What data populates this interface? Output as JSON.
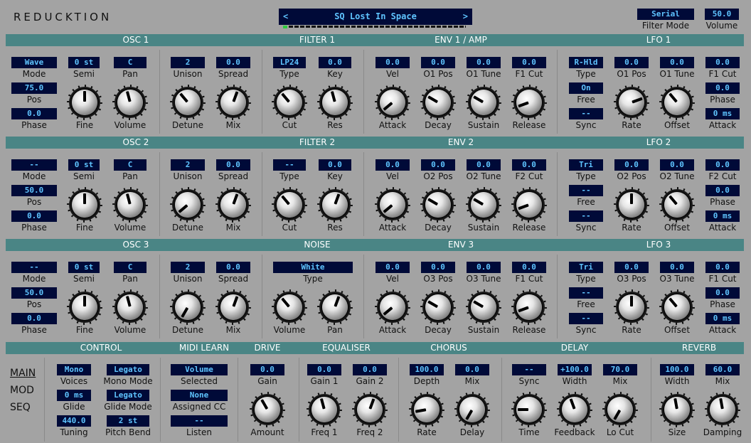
{
  "app_title": "REDUCKTION",
  "preset": {
    "prev": "<",
    "next": ">",
    "name": "SQ Lost In Space"
  },
  "header": {
    "filter_mode_value": "Serial",
    "filter_mode_label": "Filter Mode",
    "volume_value": "50.0",
    "volume_label": "Volume"
  },
  "bands": {
    "osc1": "OSC 1",
    "filter1": "FILTER 1",
    "env1": "ENV 1 / AMP",
    "lfo1": "LFO 1",
    "osc2": "OSC 2",
    "filter2": "FILTER 2",
    "env2": "ENV 2",
    "lfo2": "LFO 2",
    "osc3": "OSC 3",
    "noise": "NOISE",
    "env3": "ENV 3",
    "lfo3": "LFO 3",
    "control": "CONTROL",
    "midi": "MIDI LEARN",
    "drive": "DRIVE",
    "eq": "EQUALISER",
    "chorus": "CHORUS",
    "delay": "DELAY",
    "reverb": "REVERB"
  },
  "osc1": {
    "mode": "Wave",
    "semi": "0 st",
    "pan": "C",
    "unison": "2",
    "spread": "0.0",
    "pos": "75.0",
    "phase": "0.0"
  },
  "osc2": {
    "mode": "--",
    "semi": "0 st",
    "pan": "C",
    "unison": "2",
    "spread": "0.0",
    "pos": "50.0",
    "phase": "0.0"
  },
  "osc3": {
    "mode": "--",
    "semi": "0 st",
    "pan": "C",
    "unison": "2",
    "spread": "0.0",
    "pos": "50.0",
    "phase": "0.0"
  },
  "filter1": {
    "type": "LP24",
    "key": "0.0"
  },
  "filter2": {
    "type": "--",
    "key": "0.0"
  },
  "noise": {
    "type": "White"
  },
  "env1": {
    "vel": "0.0",
    "a": "0.0",
    "b": "0.0",
    "c": "0.0",
    "l_a": "O1 Pos",
    "l_b": "O1 Tune",
    "l_c": "F1 Cut"
  },
  "env2": {
    "vel": "0.0",
    "a": "0.0",
    "b": "0.0",
    "c": "0.0",
    "l_a": "O2 Pos",
    "l_b": "O2 Tune",
    "l_c": "F2 Cut"
  },
  "env3": {
    "vel": "0.0",
    "a": "0.0",
    "b": "0.0",
    "c": "0.0",
    "l_a": "O3 Pos",
    "l_b": "O3 Tune",
    "l_c": "F1 Cut"
  },
  "lfo1": {
    "type": "R-Hld",
    "a": "0.0",
    "b": "0.0",
    "c": "0.0",
    "free": "On",
    "phase": "0.0",
    "sync": "--",
    "attack": "0 ms",
    "l_a": "O1 Pos",
    "l_b": "O1 Tune",
    "l_c": "F1 Cut"
  },
  "lfo2": {
    "type": "Tri",
    "a": "0.0",
    "b": "0.0",
    "c": "0.0",
    "free": "--",
    "phase": "0.0",
    "sync": "--",
    "attack": "0 ms",
    "l_a": "O2 Pos",
    "l_b": "O2 Tune",
    "l_c": "F2 Cut"
  },
  "lfo3": {
    "type": "Tri",
    "a": "0.0",
    "b": "0.0",
    "c": "0.0",
    "free": "--",
    "phase": "0.0",
    "sync": "--",
    "attack": "0 ms",
    "l_a": "O3 Pos",
    "l_b": "O3 Tune",
    "l_c": "F1 Cut"
  },
  "labels": {
    "mode": "Mode",
    "semi": "Semi",
    "pan": "Pan",
    "pos": "Pos",
    "phase": "Phase",
    "fine": "Fine",
    "volume": "Volume",
    "unison": "Unison",
    "spread": "Spread",
    "detune": "Detune",
    "mix": "Mix",
    "type": "Type",
    "key": "Key",
    "cut": "Cut",
    "res": "Res",
    "vel": "Vel",
    "attack": "Attack",
    "decay": "Decay",
    "sustain": "Sustain",
    "release": "Release",
    "free": "Free",
    "sync": "Sync",
    "rate": "Rate",
    "offset": "Offset",
    "noise_volume": "Volume",
    "noise_pan": "Pan"
  },
  "control": {
    "voices": "Mono",
    "voices_l": "Voices",
    "mono_mode": "Legato",
    "mono_mode_l": "Mono Mode",
    "glide": "0 ms",
    "glide_l": "Glide",
    "glide_mode": "Legato",
    "glide_mode_l": "Glide Mode",
    "tuning": "440.0",
    "tuning_l": "Tuning",
    "pitch_bend": "2 st",
    "pitch_bend_l": "Pitch Bend"
  },
  "midi": {
    "selected": "Volume",
    "selected_l": "Selected",
    "assigned": "None",
    "assigned_l": "Assigned CC",
    "listen": "--",
    "listen_l": "Listen"
  },
  "drive": {
    "gain": "0.0",
    "gain_l": "Gain",
    "amount_l": "Amount"
  },
  "eq": {
    "gain1": "0.0",
    "gain1_l": "Gain 1",
    "gain2": "0.0",
    "gain2_l": "Gain 2",
    "freq1_l": "Freq 1",
    "freq2_l": "Freq 2"
  },
  "chorus": {
    "depth": "100.0",
    "depth_l": "Depth",
    "mix": "0.0",
    "mix_l": "Mix",
    "rate_l": "Rate",
    "delay_l": "Delay"
  },
  "delay": {
    "sync": "--",
    "sync_l": "Sync",
    "width": "+100.0",
    "width_l": "Width",
    "mix": "70.0",
    "mix_l": "Mix",
    "time_l": "Time",
    "feedback_l": "Feedback",
    "locut_l": "Lo Cut"
  },
  "reverb": {
    "width": "100.0",
    "width_l": "Width",
    "mix": "60.0",
    "mix_l": "Mix",
    "size_l": "Size",
    "damping_l": "Damping"
  },
  "nav": {
    "main": "MAIN",
    "mod": "MOD",
    "seq": "SEQ"
  }
}
